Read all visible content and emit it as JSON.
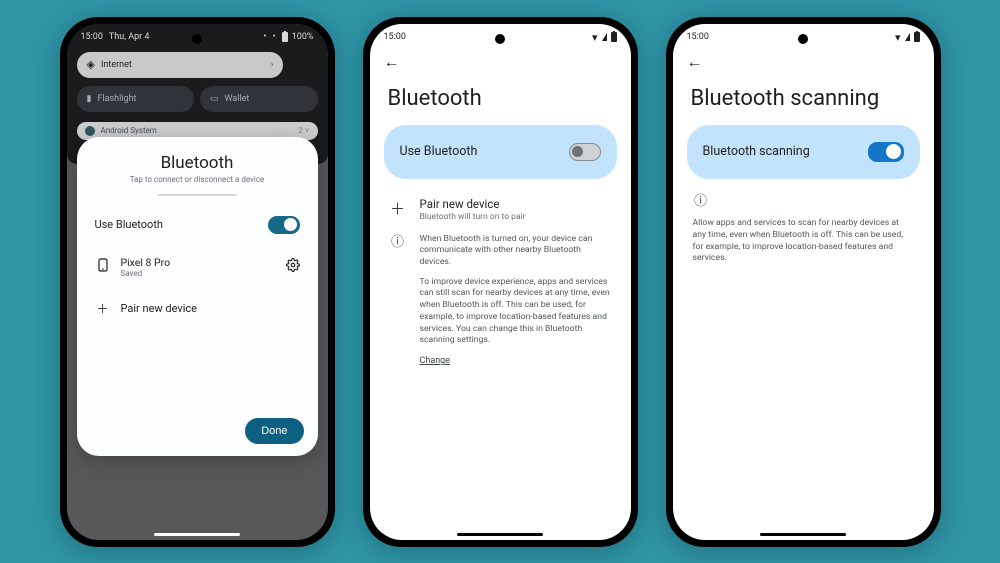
{
  "phone1": {
    "status": {
      "time": "15:00",
      "date": "Thu, Apr 4",
      "battery": "100%"
    },
    "qs": {
      "internet": {
        "label": "Internet",
        "icon": "wifi-icon"
      },
      "flashlight": {
        "label": "Flashlight"
      },
      "wallet": {
        "label": "Wallet"
      }
    },
    "notif": {
      "title": "Android System",
      "collapse": "2 ˅"
    },
    "sheet": {
      "title": "Bluetooth",
      "subtitle": "Tap to connect or disconnect a device",
      "use_bt_label": "Use Bluetooth",
      "device": {
        "name": "Pixel 8 Pro",
        "status": "Saved"
      },
      "pair_label": "Pair new device",
      "done_label": "Done"
    }
  },
  "phone2": {
    "status": {
      "time": "15:00"
    },
    "title": "Bluetooth",
    "use_bt_label": "Use Bluetooth",
    "pair": {
      "label": "Pair new device",
      "sub": "Bluetooth will turn on to pair"
    },
    "info1": "When Bluetooth is turned on, your device can communicate with other nearby Bluetooth devices.",
    "info2": "To improve device experience, apps and services can still scan for nearby devices at any time, even when Bluetooth is off. This can be used, for example, to improve location-based features and services. You can change this in Bluetooth scanning settings.",
    "change_label": "Change"
  },
  "phone3": {
    "status": {
      "time": "15:00"
    },
    "title": "Bluetooth scanning",
    "toggle_label": "Bluetooth scanning",
    "desc": "Allow apps and services to scan for nearby devices at any time, even when Bluetooth is off. This can be used, for example, to improve location-based features and services."
  }
}
